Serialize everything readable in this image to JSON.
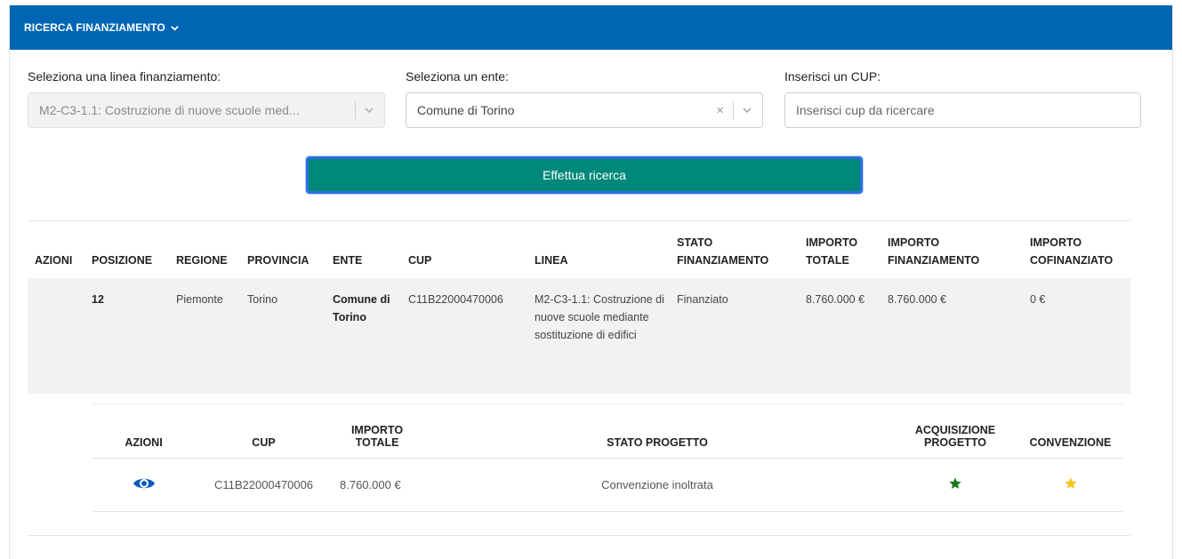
{
  "header": {
    "title": "RICERCA FINANZIAMENTO"
  },
  "filters": {
    "linea": {
      "label": "Seleziona una linea finanziamento:",
      "value": "M2-C3-1.1: Costruzione di nuove scuole med..."
    },
    "ente": {
      "label": "Seleziona un ente:",
      "value": "Comune di Torino"
    },
    "cup": {
      "label": "Inserisci un CUP:",
      "placeholder": "Inserisci cup da ricercare"
    }
  },
  "search_button": "Effettua ricerca",
  "table": {
    "headers": [
      "AZIONI",
      "POSIZIONE",
      "REGIONE",
      "PROVINCIA",
      "ENTE",
      "CUP",
      "LINEA",
      "STATO FINANZIAMENTO",
      "IMPORTO TOTALE",
      "IMPORTO FINANZIAMENTO",
      "IMPORTO COFINANZIATO"
    ],
    "row": {
      "azioni": "",
      "posizione": "12",
      "regione": "Piemonte",
      "provincia": "Torino",
      "ente": "Comune di Torino",
      "cup": "C11B22000470006",
      "linea": "M2-C3-1.1: Costruzione di nuove scuole mediante sostituzione di edifici",
      "stato": "Finanziato",
      "importo_totale": "8.760.000 €",
      "importo_finanziamento": "8.760.000 €",
      "importo_cofinanziato": "0 €"
    }
  },
  "subtable": {
    "headers": [
      "AZIONI",
      "CUP",
      "IMPORTO TOTALE",
      "STATO PROGETTO",
      "ACQUISIZIONE PROGETTO",
      "CONVENZIONE"
    ],
    "row": {
      "azioni_icon": "eye-icon",
      "cup": "C11B22000470006",
      "importo_totale": "8.760.000 €",
      "stato_progetto": "Convenzione inoltrata",
      "acquisizione_icon": "star-icon",
      "convenzione_icon": "star-icon"
    }
  },
  "colors": {
    "header_bg": "#0066b3",
    "button_bg": "#00897b",
    "star_green": "#1a7a1a",
    "star_yellow": "#f5c518",
    "eye_blue": "#0a5cb8"
  }
}
